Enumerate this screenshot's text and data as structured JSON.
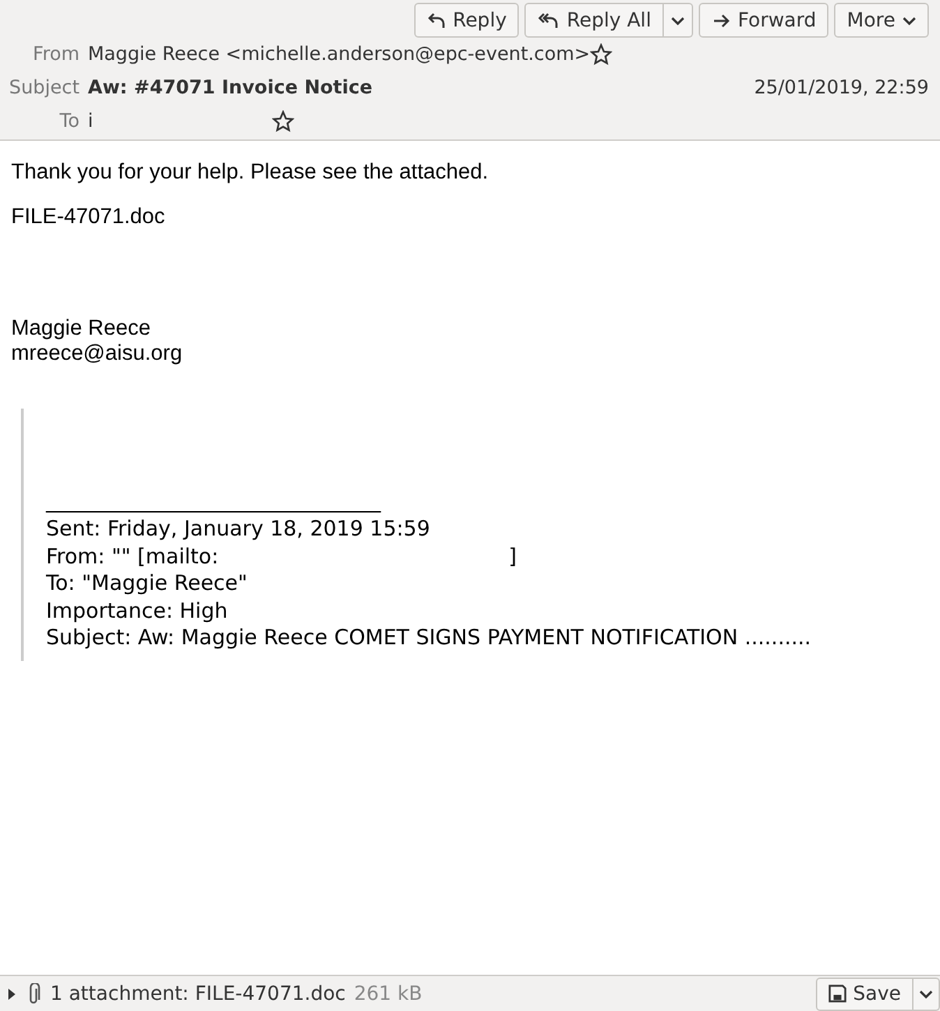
{
  "toolbar": [
    {
      "kind": "reply",
      "label": "Reply"
    },
    {
      "kind": "reply-all",
      "label": "Reply All"
    },
    {
      "kind": "forward",
      "label": "Forward"
    },
    {
      "kind": "more",
      "label": "More"
    }
  ],
  "header": {
    "from_label": "From",
    "from": "Maggie Reece <michelle.anderson@epc-event.com>",
    "subject_label": "Subject",
    "subject": "Aw: #47071 Invoice Notice",
    "date": "25/01/2019, 22:59",
    "to_label": "To",
    "to": "i"
  },
  "body": {
    "lines": [
      "Thank you for your help. Please see the attached.",
      "FILE-47071.doc"
    ],
    "signature": [
      "Maggie Reece",
      "mreece@aisu.org"
    ],
    "quote": {
      "rule": "________________________________",
      "sent": "Sent: Friday, January 18, 2019 15:59",
      "from_start": "From: \"\" [mailto:",
      "from_end": "]",
      "to": "To: \"Maggie Reece\"",
      "importance": "Importance: High",
      "subject": "Subject: Aw: Maggie Reece COMET SIGNS PAYMENT NOTIFICATION .........."
    }
  },
  "attachments": {
    "expanded": false,
    "summary": "1 attachment: FILE-47071.doc",
    "size": "261 kB",
    "save": "Save"
  }
}
